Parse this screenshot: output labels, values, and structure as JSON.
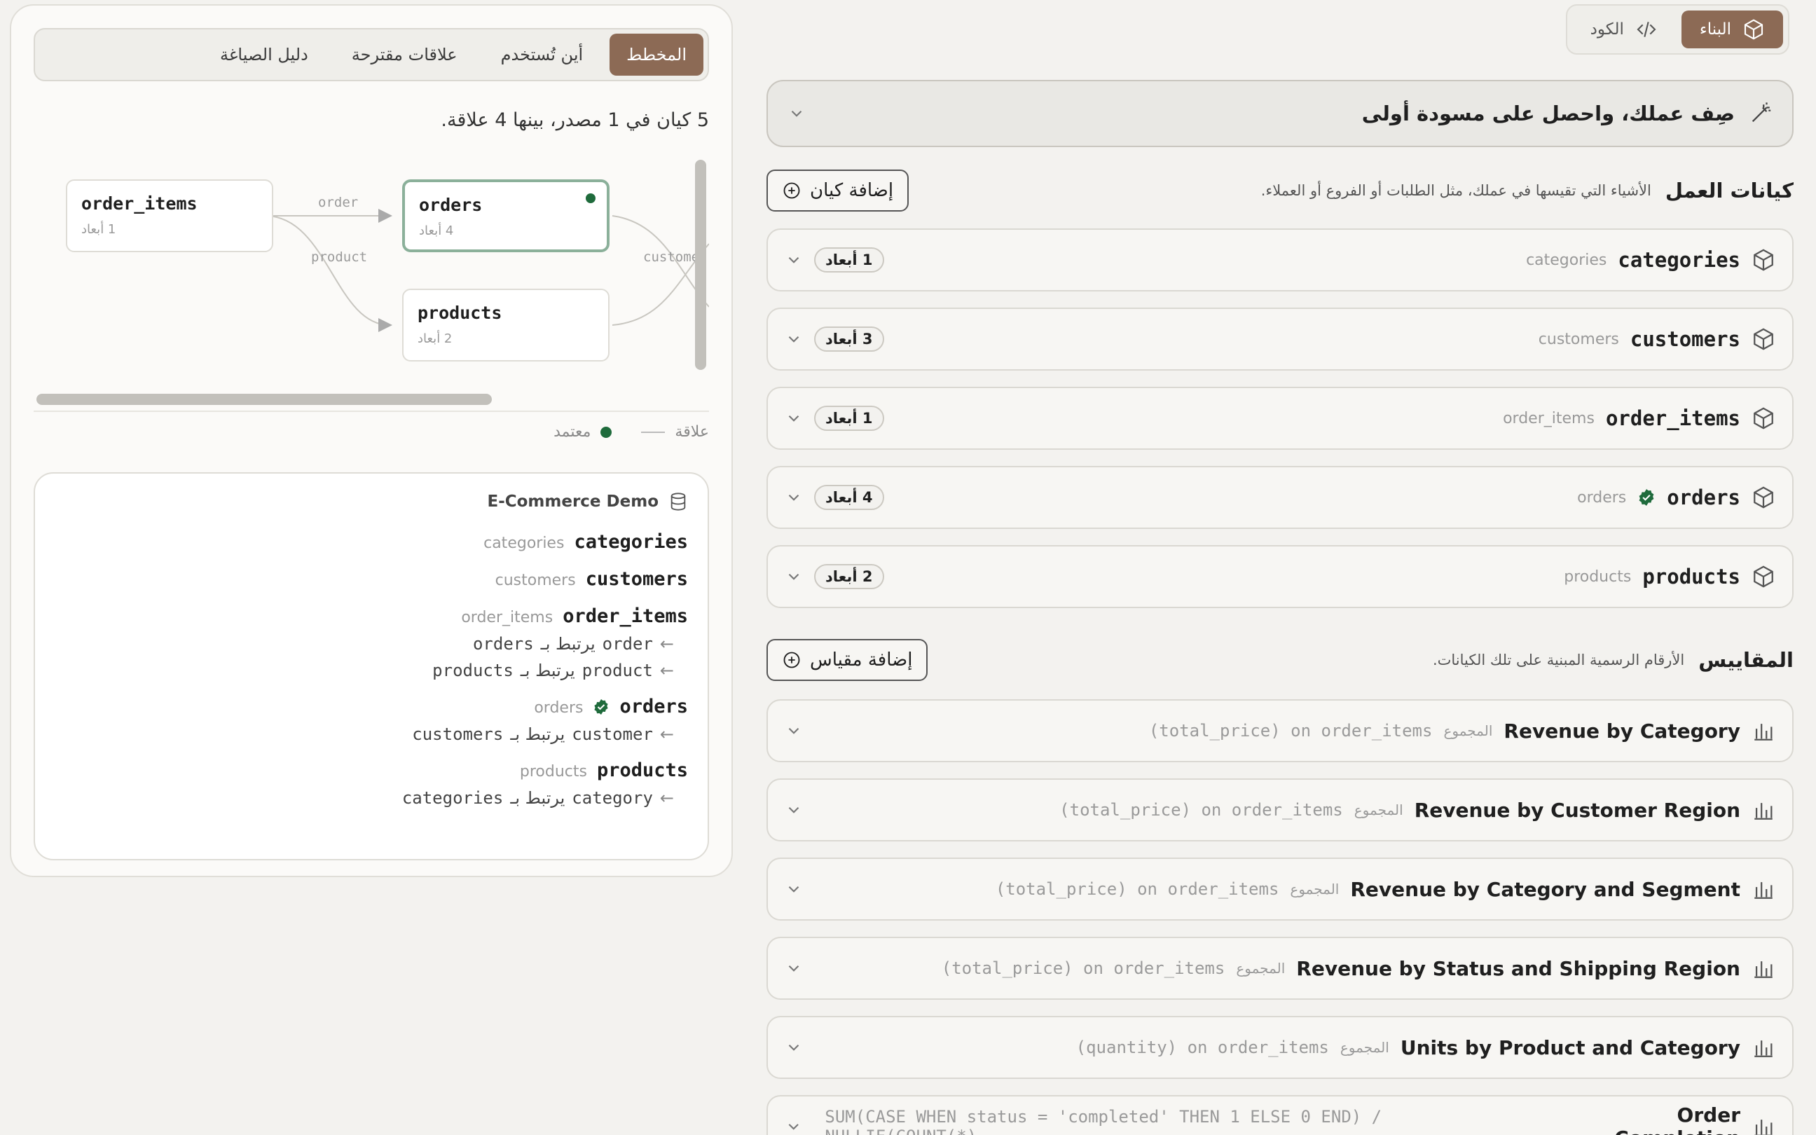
{
  "builder": {
    "mode_build": "البناء",
    "mode_code": "الكود",
    "describe": "صِف عملك، واحصل على مسودة أولى",
    "entities_title": "كيانات العمل",
    "entities_desc": "الأشياء التي تقيسها في عملك، مثل الطلبات أو الفروع أو العملاء.",
    "add_entity": "إضافة كيان",
    "entities": [
      {
        "name": "categories",
        "sub": "categories",
        "dims": "1 أبعاد",
        "certified": false
      },
      {
        "name": "customers",
        "sub": "customers",
        "dims": "3 أبعاد",
        "certified": false
      },
      {
        "name": "order_items",
        "sub": "order_items",
        "dims": "1 أبعاد",
        "certified": false
      },
      {
        "name": "orders",
        "sub": "orders",
        "dims": "4 أبعاد",
        "certified": true
      },
      {
        "name": "products",
        "sub": "products",
        "dims": "2 أبعاد",
        "certified": false
      }
    ],
    "metrics_title": "المقاييس",
    "metrics_desc": "الأرقام الرسمية المبنية على تلك الكيانات.",
    "add_metric": "إضافة مقياس",
    "metrics": [
      {
        "name": "Revenue by Category",
        "agg": "المجموع",
        "expr": "(total_price) on order_items"
      },
      {
        "name": "Revenue by Customer Region",
        "agg": "المجموع",
        "expr": "(total_price) on order_items"
      },
      {
        "name": "Revenue by Category and Segment",
        "agg": "المجموع",
        "expr": "(total_price) on order_items"
      },
      {
        "name": "Revenue by Status and Shipping Region",
        "agg": "المجموع",
        "expr": "(total_price) on order_items"
      },
      {
        "name": "Units by Product and Category",
        "agg": "المجموع",
        "expr": "(quantity) on order_items"
      },
      {
        "name": "Order Completion",
        "agg": "",
        "expr": "SUM(CASE WHEN status = 'completed' THEN 1 ELSE 0 END) / NULLIF(COUNT(*),"
      }
    ]
  },
  "panel": {
    "tabs": [
      "المخطط",
      "أين تُستخدم",
      "علاقات مقترحة",
      "دليل الصياغة"
    ],
    "summary": "5 كيان في 1 مصدر، بينها 4 علاقة.",
    "nodes": [
      {
        "name": "order_items",
        "dims": "1 أبعاد"
      },
      {
        "name": "orders",
        "dims": "4 أبعاد"
      },
      {
        "name": "products",
        "dims": "2 أبعاد"
      }
    ],
    "edge_labels": {
      "order": "order",
      "product": "product",
      "customer": "custome"
    },
    "legend_relation": "علاقة",
    "legend_certified": "معتمد",
    "source_name": "E-Commerce Demo",
    "source_entities": [
      {
        "name": "categories",
        "sub": "categories",
        "certified": false,
        "rels": []
      },
      {
        "name": "customers",
        "sub": "customers",
        "certified": false,
        "rels": []
      },
      {
        "name": "order_items",
        "sub": "order_items",
        "certified": false,
        "rels": [
          {
            "field": "order",
            "text": "يرتبط بـ",
            "target": "orders"
          },
          {
            "field": "product",
            "text": "يرتبط بـ",
            "target": "products"
          }
        ]
      },
      {
        "name": "orders",
        "sub": "orders",
        "certified": true,
        "rels": [
          {
            "field": "customer",
            "text": "يرتبط بـ",
            "target": "customers"
          }
        ]
      },
      {
        "name": "products",
        "sub": "products",
        "certified": false,
        "rels": [
          {
            "field": "category",
            "text": "يرتبط بـ",
            "target": "categories"
          }
        ]
      }
    ]
  },
  "colors": {
    "accent": "#8c6a55",
    "certified": "#1f6b3c"
  }
}
